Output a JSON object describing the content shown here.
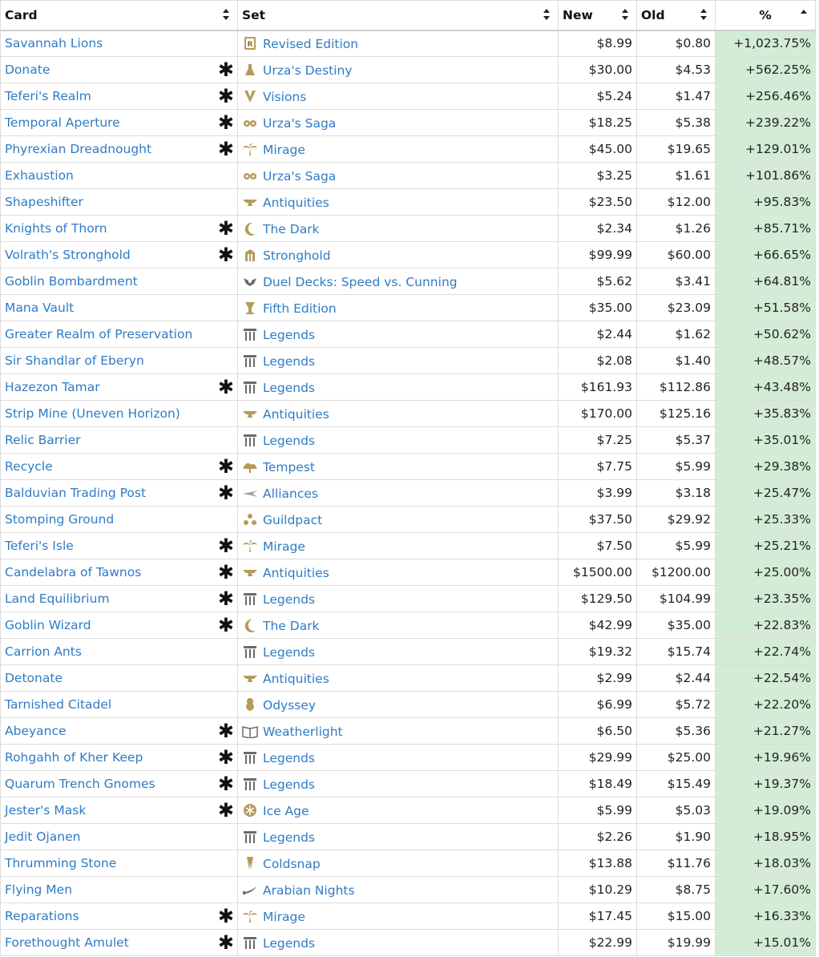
{
  "columns": {
    "card": "Card",
    "set": "Set",
    "new": "New",
    "old": "Old",
    "pct": "%"
  },
  "accent": {
    "link": "#2f7bc5",
    "pct_bg": "#d4ecd6",
    "icon": "#b59a5a"
  },
  "star_symbol": "✱",
  "rows": [
    {
      "card": "Savannah Lions",
      "star": false,
      "set": "Revised Edition",
      "icon": "revised-icon",
      "new": "$8.99",
      "old": "$0.80",
      "pct": "+1,023.75%"
    },
    {
      "card": "Donate",
      "star": true,
      "set": "Urza's Destiny",
      "icon": "flask-icon",
      "new": "$30.00",
      "old": "$4.53",
      "pct": "+562.25%"
    },
    {
      "card": "Teferi's Realm",
      "star": true,
      "set": "Visions",
      "icon": "visions-icon",
      "new": "$5.24",
      "old": "$1.47",
      "pct": "+256.46%"
    },
    {
      "card": "Temporal Aperture",
      "star": true,
      "set": "Urza's Saga",
      "icon": "gears-icon",
      "new": "$18.25",
      "old": "$5.38",
      "pct": "+239.22%"
    },
    {
      "card": "Phyrexian Dreadnought",
      "star": true,
      "set": "Mirage",
      "icon": "palm-icon",
      "new": "$45.00",
      "old": "$19.65",
      "pct": "+129.01%"
    },
    {
      "card": "Exhaustion",
      "star": false,
      "set": "Urza's Saga",
      "icon": "gears-icon",
      "new": "$3.25",
      "old": "$1.61",
      "pct": "+101.86%"
    },
    {
      "card": "Shapeshifter",
      "star": false,
      "set": "Antiquities",
      "icon": "anvil-icon",
      "new": "$23.50",
      "old": "$12.00",
      "pct": "+95.83%"
    },
    {
      "card": "Knights of Thorn",
      "star": true,
      "set": "The Dark",
      "icon": "moon-icon",
      "new": "$2.34",
      "old": "$1.26",
      "pct": "+85.71%"
    },
    {
      "card": "Volrath's Stronghold",
      "star": true,
      "set": "Stronghold",
      "icon": "stronghold-icon",
      "new": "$99.99",
      "old": "$60.00",
      "pct": "+66.65%"
    },
    {
      "card": "Goblin Bombardment",
      "star": false,
      "set": "Duel Decks: Speed vs. Cunning",
      "icon": "duel-decks-icon",
      "new": "$5.62",
      "old": "$3.41",
      "pct": "+64.81%"
    },
    {
      "card": "Mana Vault",
      "star": false,
      "set": "Fifth Edition",
      "icon": "fifth-edition-icon",
      "new": "$35.00",
      "old": "$23.09",
      "pct": "+51.58%"
    },
    {
      "card": "Greater Realm of Preservation",
      "star": false,
      "set": "Legends",
      "icon": "column-icon",
      "new": "$2.44",
      "old": "$1.62",
      "pct": "+50.62%"
    },
    {
      "card": "Sir Shandlar of Eberyn",
      "star": false,
      "set": "Legends",
      "icon": "column-icon",
      "new": "$2.08",
      "old": "$1.40",
      "pct": "+48.57%"
    },
    {
      "card": "Hazezon Tamar",
      "star": true,
      "set": "Legends",
      "icon": "column-icon",
      "new": "$161.93",
      "old": "$112.86",
      "pct": "+43.48%"
    },
    {
      "card": "Strip Mine (Uneven Horizon)",
      "star": false,
      "set": "Antiquities",
      "icon": "anvil-icon",
      "new": "$170.00",
      "old": "$125.16",
      "pct": "+35.83%"
    },
    {
      "card": "Relic Barrier",
      "star": false,
      "set": "Legends",
      "icon": "column-icon",
      "new": "$7.25",
      "old": "$5.37",
      "pct": "+35.01%"
    },
    {
      "card": "Recycle",
      "star": true,
      "set": "Tempest",
      "icon": "cloud-icon",
      "new": "$7.75",
      "old": "$5.99",
      "pct": "+29.38%"
    },
    {
      "card": "Balduvian Trading Post",
      "star": true,
      "set": "Alliances",
      "icon": "alliances-icon",
      "new": "$3.99",
      "old": "$3.18",
      "pct": "+25.47%"
    },
    {
      "card": "Stomping Ground",
      "star": false,
      "set": "Guildpact",
      "icon": "guildpact-icon",
      "new": "$37.50",
      "old": "$29.92",
      "pct": "+25.33%"
    },
    {
      "card": "Teferi's Isle",
      "star": true,
      "set": "Mirage",
      "icon": "palm-icon",
      "new": "$7.50",
      "old": "$5.99",
      "pct": "+25.21%"
    },
    {
      "card": "Candelabra of Tawnos",
      "star": true,
      "set": "Antiquities",
      "icon": "anvil-icon",
      "new": "$1500.00",
      "old": "$1200.00",
      "pct": "+25.00%"
    },
    {
      "card": "Land Equilibrium",
      "star": true,
      "set": "Legends",
      "icon": "column-icon",
      "new": "$129.50",
      "old": "$104.99",
      "pct": "+23.35%"
    },
    {
      "card": "Goblin Wizard",
      "star": true,
      "set": "The Dark",
      "icon": "moon-icon",
      "new": "$42.99",
      "old": "$35.00",
      "pct": "+22.83%"
    },
    {
      "card": "Carrion Ants",
      "star": false,
      "set": "Legends",
      "icon": "column-icon",
      "new": "$19.32",
      "old": "$15.74",
      "pct": "+22.74%"
    },
    {
      "card": "Detonate",
      "star": false,
      "set": "Antiquities",
      "icon": "anvil-icon",
      "new": "$2.99",
      "old": "$2.44",
      "pct": "+22.54%"
    },
    {
      "card": "Tarnished Citadel",
      "star": false,
      "set": "Odyssey",
      "icon": "odyssey-icon",
      "new": "$6.99",
      "old": "$5.72",
      "pct": "+22.20%"
    },
    {
      "card": "Abeyance",
      "star": true,
      "set": "Weatherlight",
      "icon": "book-icon",
      "new": "$6.50",
      "old": "$5.36",
      "pct": "+21.27%"
    },
    {
      "card": "Rohgahh of Kher Keep",
      "star": true,
      "set": "Legends",
      "icon": "column-icon",
      "new": "$29.99",
      "old": "$25.00",
      "pct": "+19.96%"
    },
    {
      "card": "Quarum Trench Gnomes",
      "star": true,
      "set": "Legends",
      "icon": "column-icon",
      "new": "$18.49",
      "old": "$15.49",
      "pct": "+19.37%"
    },
    {
      "card": "Jester's Mask",
      "star": true,
      "set": "Ice Age",
      "icon": "snowflake-icon",
      "new": "$5.99",
      "old": "$5.03",
      "pct": "+19.09%"
    },
    {
      "card": "Jedit Ojanen",
      "star": false,
      "set": "Legends",
      "icon": "column-icon",
      "new": "$2.26",
      "old": "$1.90",
      "pct": "+18.95%"
    },
    {
      "card": "Thrumming Stone",
      "star": false,
      "set": "Coldsnap",
      "icon": "coldsnap-icon",
      "new": "$13.88",
      "old": "$11.76",
      "pct": "+18.03%"
    },
    {
      "card": "Flying Men",
      "star": false,
      "set": "Arabian Nights",
      "icon": "scimitar-icon",
      "new": "$10.29",
      "old": "$8.75",
      "pct": "+17.60%"
    },
    {
      "card": "Reparations",
      "star": true,
      "set": "Mirage",
      "icon": "palm-icon",
      "new": "$17.45",
      "old": "$15.00",
      "pct": "+16.33%"
    },
    {
      "card": "Forethought Amulet",
      "star": true,
      "set": "Legends",
      "icon": "column-icon",
      "new": "$22.99",
      "old": "$19.99",
      "pct": "+15.01%"
    }
  ]
}
